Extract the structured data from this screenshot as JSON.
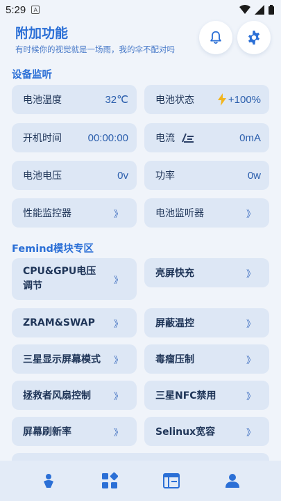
{
  "status": {
    "time": "5:29"
  },
  "header": {
    "title": "附加功能",
    "subtitle": "有时候你的视觉就是一场雨，我的伞不配对吗"
  },
  "sections": {
    "monitor_title": "设备监听",
    "femind_title": "Femind模块专区"
  },
  "monitor": {
    "battery_temp_label": "电池温度",
    "battery_temp_value": "32℃",
    "battery_state_label": "电池状态",
    "battery_state_value": "+100%",
    "uptime_label": "开机时间",
    "uptime_value": "00:00:00",
    "current_label": "电流",
    "current_value": "0mA",
    "voltage_label": "电池电压",
    "voltage_value": "0v",
    "power_label": "功率",
    "power_value": "0w",
    "perf_monitor_label": "性能监控器",
    "battery_listener_label": "电池监听器"
  },
  "modules": {
    "cpu_gpu_voltage": "CPU&GPU电压调节",
    "fast_charge": "亮屏快充",
    "zram_swap": "ZRAM&SWAP",
    "temp_block": "屏蔽温控",
    "samsung_display": "三星显示屏幕模式",
    "tumor_suppress": "毒瘤压制",
    "rescuer_fan": "拯救者风扇控制",
    "samsung_nfc": "三星NFC禁用",
    "refresh_rate": "屏幕刷新率",
    "selinux": "Selinux宽容"
  },
  "chevron": "》",
  "colors": {
    "accent": "#2b6fd6",
    "card": "#dde7f5",
    "background": "#f0f4fa"
  }
}
